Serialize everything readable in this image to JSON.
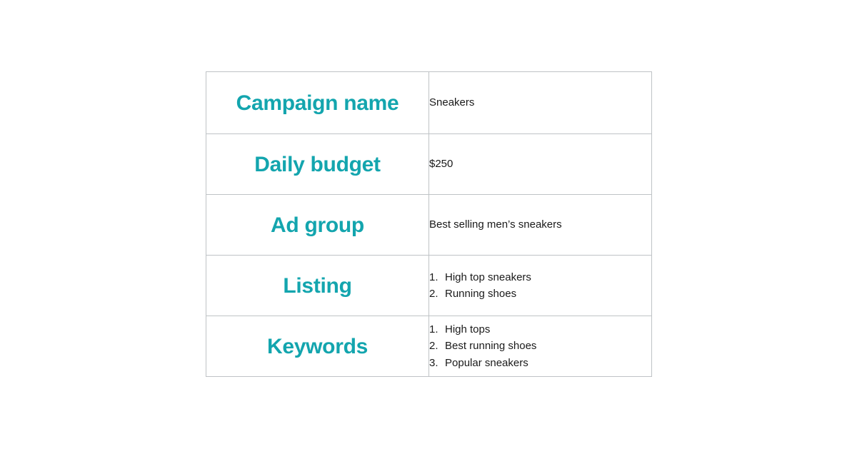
{
  "page": {
    "background_color": "#ffffff",
    "accent_color": "#13a5ae",
    "text_color": "#1a1a1a",
    "border_color": "#bfc3c6"
  },
  "table": {
    "rows": [
      {
        "label": "Campaign name",
        "value_type": "text",
        "value": "Sneakers"
      },
      {
        "label": "Daily budget",
        "value_type": "text",
        "value": "$250"
      },
      {
        "label": "Ad group",
        "value_type": "text",
        "value": "Best selling men’s sneakers"
      },
      {
        "label": "Listing",
        "value_type": "list",
        "items": [
          {
            "num": "1.",
            "text": "High top sneakers"
          },
          {
            "num": "2.",
            "text": "Running shoes"
          }
        ]
      },
      {
        "label": "Keywords",
        "value_type": "list",
        "items": [
          {
            "num": "1.",
            "text": "High tops"
          },
          {
            "num": "2.",
            "text": "Best running shoes"
          },
          {
            "num": "3.",
            "text": "Popular sneakers"
          }
        ]
      }
    ]
  }
}
